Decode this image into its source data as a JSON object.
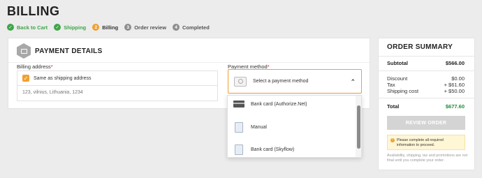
{
  "page": {
    "title": "BILLING"
  },
  "steps": [
    {
      "label": "Back to Cart",
      "icon": "check-icon",
      "glyph": "✓",
      "state": "done"
    },
    {
      "label": "Shipping",
      "icon": "check-icon",
      "glyph": "✓",
      "state": "done"
    },
    {
      "label": "Billing",
      "icon": "step-number",
      "glyph": "2",
      "state": "active"
    },
    {
      "label": "Order review",
      "icon": "step-number",
      "glyph": "3",
      "state": "todo"
    },
    {
      "label": "Completed",
      "icon": "step-number",
      "glyph": "4",
      "state": "todo"
    }
  ],
  "payment": {
    "title": "PAYMENT DETAILS",
    "billing_label": "Billing address",
    "required_mark": "*",
    "same_as_shipping": "Same as shipping address",
    "address": "123, vilnius, Lithuania, 1234",
    "method_label": "Payment method",
    "select_placeholder": "Select a payment method",
    "options": [
      {
        "label": "Bank card (Authorize.Net)",
        "icon": "credit-card-icon"
      },
      {
        "label": "Manual",
        "icon": "document-icon"
      },
      {
        "label": "Bank card (Skyflow)",
        "icon": "document-icon"
      }
    ]
  },
  "summary": {
    "title": "ORDER SUMMARY",
    "subtotal_label": "Subtotal",
    "subtotal_value": "$566.00",
    "discount_label": "Discount",
    "discount_value": "$0.00",
    "tax_label": "Tax",
    "tax_value": "+ $61.60",
    "shipping_label": "Shipping cost",
    "shipping_value": "+ $50.00",
    "total_label": "Total",
    "total_value": "$677.60",
    "review_button": "REVIEW ORDER",
    "warning": "Please complete all required information to proceed.",
    "note": "Availability, shipping, tax and promotions are not final until you complete your order."
  },
  "colors": {
    "accent": "#f0a030",
    "success": "#3fa648",
    "total": "#1e8c3a"
  }
}
